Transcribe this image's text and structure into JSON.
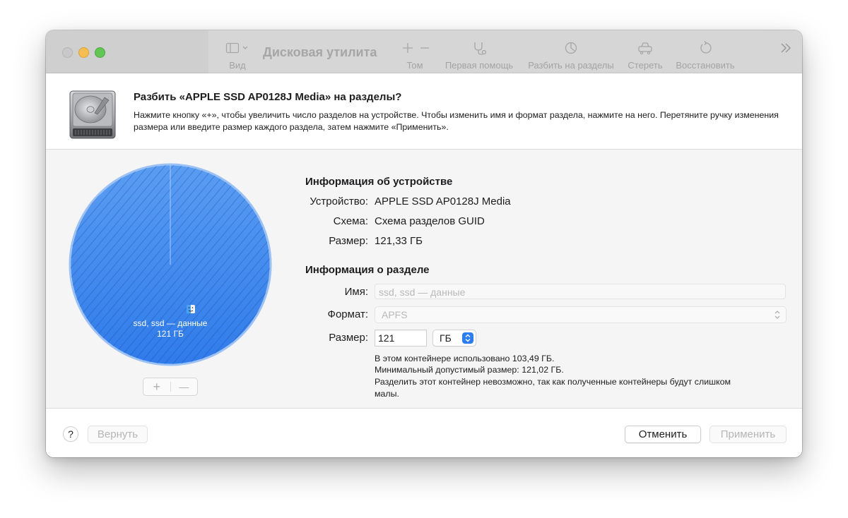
{
  "window": {
    "title": "Дисковая утилита"
  },
  "toolbar": {
    "view_label": "Вид",
    "volume_label": "Том",
    "first_aid_label": "Первая помощь",
    "partition_label": "Разбить на разделы",
    "erase_label": "Стереть",
    "restore_label": "Восстановить"
  },
  "sheet": {
    "title": "Разбить «APPLE SSD AP0128J Media» на разделы?",
    "description": "Нажмите кнопку «+», чтобы увеличить число разделов на устройстве. Чтобы изменить имя и формат раздела, нажмите на него. Перетяните ручку изменения размера или введите размер каждого раздела, затем нажмите «Применить»."
  },
  "pie": {
    "partition_name": "ssd, ssd — данные",
    "partition_size": "121 ГБ",
    "fill_color": "#3f8cf0",
    "fraction": 1.0
  },
  "device_info": {
    "heading": "Информация об устройстве",
    "device_label": "Устройство:",
    "device_value": "APPLE SSD AP0128J Media",
    "scheme_label": "Схема:",
    "scheme_value": "Схема разделов GUID",
    "size_label": "Размер:",
    "size_value": "121,33 ГБ"
  },
  "partition_info": {
    "heading": "Информация о разделе",
    "name_label": "Имя:",
    "name_placeholder": "ssd, ssd — данные",
    "format_label": "Формат:",
    "format_value": "APFS",
    "size_label": "Размер:",
    "size_value": "121",
    "size_unit": "ГБ",
    "note_used": "В этом контейнере использовано 103,49 ГБ.",
    "note_min": "Минимальный допустимый размер: 121,02 ГБ.",
    "note_cannot": "Разделить этот контейнер невозможно, так как полученные контейнеры будут слишком малы."
  },
  "footer": {
    "help_label": "?",
    "revert_label": "Вернуть",
    "cancel_label": "Отменить",
    "apply_label": "Применить"
  },
  "pm": {
    "plus": "+",
    "minus": "—"
  }
}
